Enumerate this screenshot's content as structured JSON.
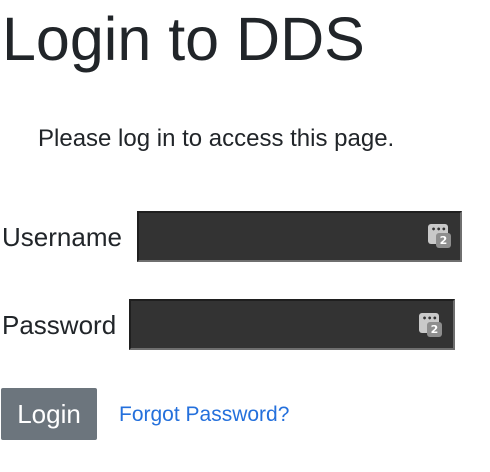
{
  "page": {
    "title": "Login to DDS",
    "intro": "Please log in to access this page."
  },
  "form": {
    "username_label": "Username",
    "username_value": "",
    "password_label": "Password",
    "password_value": "",
    "password_manager_badge": "2",
    "password_manager_dots": "•••",
    "login_label": "Login",
    "forgot_password_label": "Forgot Password?"
  },
  "colors": {
    "field_background": "#333333",
    "button_background": "#6c757d",
    "link": "#2470dc",
    "text": "#212529"
  }
}
